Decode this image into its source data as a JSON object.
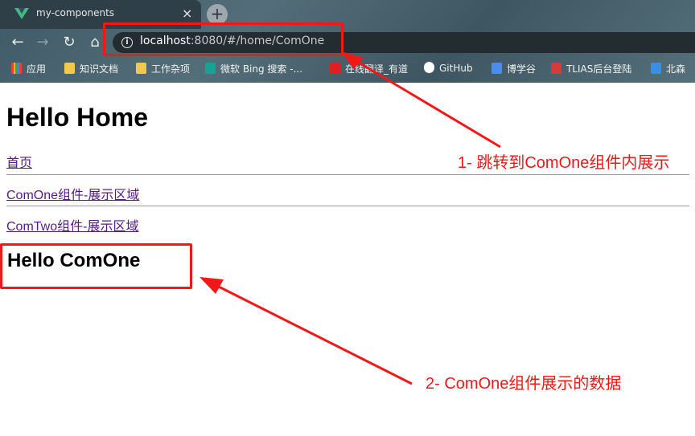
{
  "browser": {
    "tab": {
      "title": "my-components",
      "close_label": "×"
    },
    "new_tab_label": "+",
    "url": {
      "host": "localhost",
      "rest": ":8080/#/home/ComOne"
    },
    "bookmarks": [
      {
        "label": "应用",
        "icon": "apps-grid-icon",
        "color": "#e94235"
      },
      {
        "label": "知识文档",
        "icon": "folder-icon",
        "color": "#f2c94c"
      },
      {
        "label": "工作杂项",
        "icon": "folder-icon",
        "color": "#f2c94c"
      },
      {
        "label": "微软 Bing 搜索 -...",
        "icon": "bing-icon",
        "color": "#14a394"
      },
      {
        "label": "在线翻译_有道",
        "icon": "youdao-icon",
        "color": "#e02020"
      },
      {
        "label": "GitHub",
        "icon": "github-icon",
        "color": "#ffffff"
      },
      {
        "label": "博学谷",
        "icon": "boxuegu-icon",
        "color": "#4a8cf0"
      },
      {
        "label": "TLIAS后台登陆",
        "icon": "tlias-icon",
        "color": "#d43b3b"
      },
      {
        "label": "北森",
        "icon": "beisen-icon",
        "color": "#3a8ee6"
      }
    ]
  },
  "page": {
    "heading": "Hello Home",
    "links": [
      "首页",
      "ComOne组件-展示区域",
      "ComTwo组件-展示区域"
    ],
    "component_heading": "Hello ComOne"
  },
  "annotations": {
    "note1": "1- 跳转到ComOne组件内展示",
    "note2": "2- ComOne组件展示的数据",
    "color": "#f21818"
  }
}
